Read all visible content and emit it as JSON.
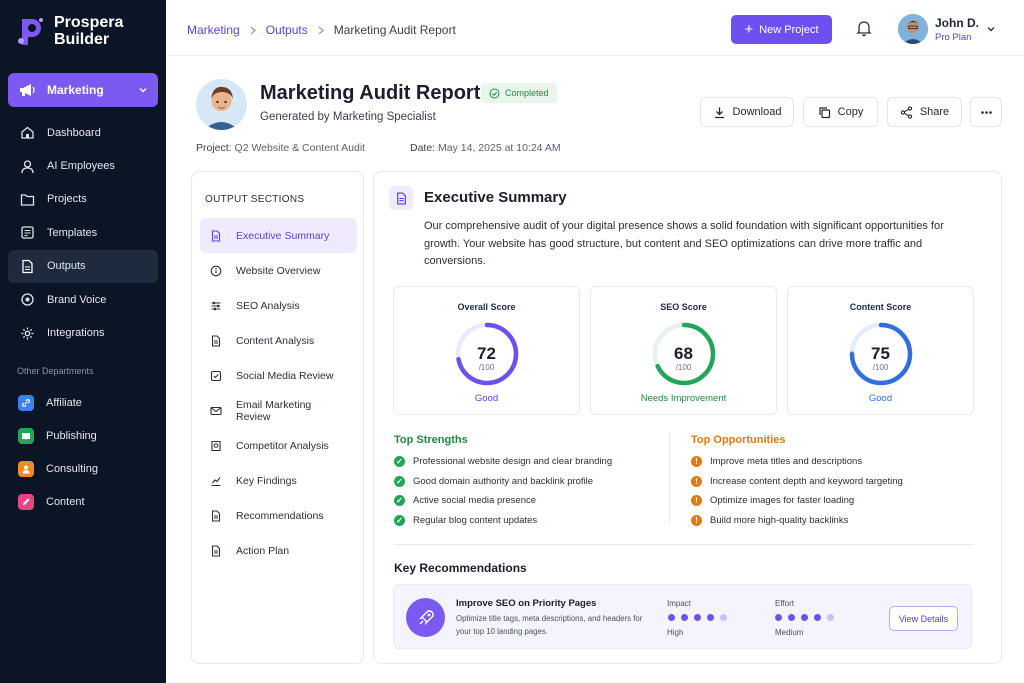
{
  "app": {
    "name_line1": "Prospera",
    "name_line2": "Builder"
  },
  "sidebar": {
    "department": "Marketing",
    "items": [
      {
        "label": "Dashboard",
        "icon": "home-icon"
      },
      {
        "label": "AI Employees",
        "icon": "user-icon"
      },
      {
        "label": "Projects",
        "icon": "folder-icon"
      },
      {
        "label": "Templates",
        "icon": "template-icon"
      },
      {
        "label": "Outputs",
        "icon": "document-icon",
        "active": true
      },
      {
        "label": "Brand Voice",
        "icon": "target-icon"
      },
      {
        "label": "Integrations",
        "icon": "gear-icon"
      }
    ],
    "other_label": "Other Departments",
    "departments": [
      {
        "label": "Affiliate",
        "color": "#3b82f6"
      },
      {
        "label": "Publishing",
        "color": "#22a559"
      },
      {
        "label": "Consulting",
        "color": "#f08a24"
      },
      {
        "label": "Content",
        "color": "#e64584"
      }
    ]
  },
  "header": {
    "breadcrumb": [
      "Marketing",
      "Outputs",
      "Marketing Audit Report"
    ],
    "new_project": "New Project",
    "user_name": "John D.",
    "user_plan": "Pro Plan"
  },
  "report": {
    "title": "Marketing Audit Report",
    "status": "Completed",
    "subtitle": "Generated by Marketing Specialist",
    "project_label": "Project:",
    "project_value": "Q2 Website & Content Audit",
    "date_label": "Date:",
    "date_value": "May 14, 2025 at 10:24 AM",
    "actions": {
      "download": "Download",
      "copy": "Copy",
      "share": "Share"
    }
  },
  "sections": {
    "title": "OUTPUT SECTIONS",
    "items": [
      "Executive Summary",
      "Website Overview",
      "SEO Analysis",
      "Content Analysis",
      "Social Media Review",
      "Email Marketing Review",
      "Competitor Analysis",
      "Key Findings",
      "Recommendations",
      "Action Plan"
    ]
  },
  "summary": {
    "title": "Executive Summary",
    "body": "Our comprehensive audit of your digital presence shows a solid foundation with significant opportunities for growth. Your website has good structure, but content and SEO optimizations can drive more traffic and conversions.",
    "scores": [
      {
        "label": "Overall Score",
        "value": "72",
        "max": "/100",
        "verdict": "Good",
        "fraction": 0.72,
        "color": "#6e4ff0"
      },
      {
        "label": "SEO Score",
        "value": "68",
        "max": "/100",
        "verdict": "Needs Improvement",
        "fraction": 0.68,
        "color": "#22a559"
      },
      {
        "label": "Content Score",
        "value": "75",
        "max": "/100",
        "verdict": "Good",
        "fraction": 0.75,
        "color": "#2f6fe0"
      }
    ],
    "strengths_title": "Top Strengths",
    "strengths": [
      "Professional website design and clear branding",
      "Good domain authority and backlink profile",
      "Active social media presence",
      "Regular blog content updates"
    ],
    "opportunities_title": "Top Opportunities",
    "opportunities": [
      "Improve meta titles and descriptions",
      "Increase content depth and keyword targeting",
      "Optimize images for faster loading",
      "Build more high-quality backlinks"
    ]
  },
  "recommendations": {
    "title": "Key Recommendations",
    "item_title": "Improve SEO on Priority Pages",
    "item_desc": "Optimize title tags, meta descriptions, and headers for your top 10 landing pages.",
    "impact_label": "Impact",
    "impact_value": "High",
    "impact_level": 4,
    "effort_label": "Effort",
    "effort_value": "Medium",
    "effort_level": 4,
    "view_details": "View Details"
  },
  "colors": {
    "accent": "#6e4ff0",
    "success": "#22a559",
    "warning": "#e07b12",
    "sidebar": "#0c1526"
  }
}
